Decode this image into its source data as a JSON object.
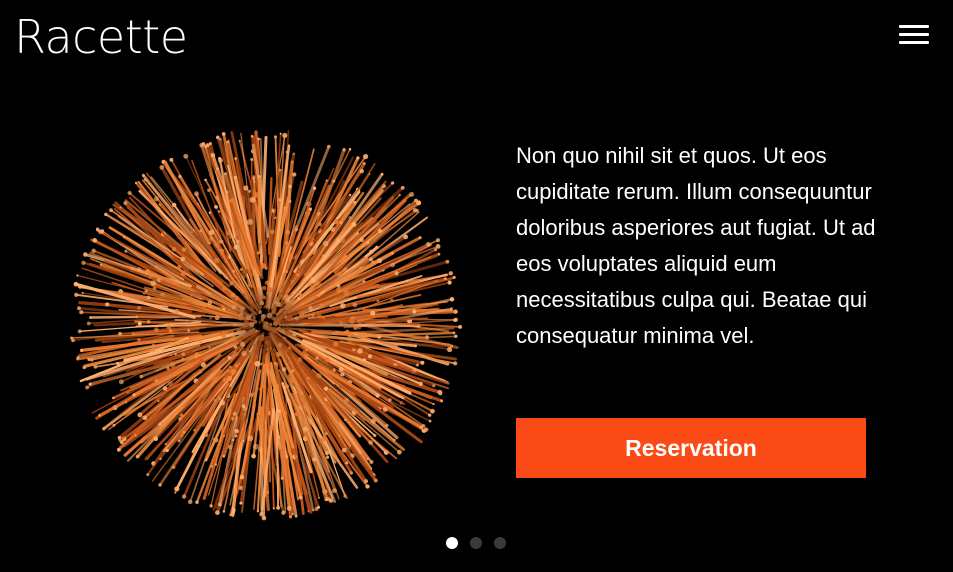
{
  "header": {
    "logo_text": "Racette",
    "menu_icon": "hamburger-menu-icon"
  },
  "hero": {
    "image_subject": "pasta-burst-image",
    "description": "Non quo nihil sit et quos. Ut eos cupiditate rerum. Illum consequuntur doloribus asperiores aut fugiat. Ut ad eos voluptates aliquid eum necessitatibus culpa qui. Beatae qui consequatur minima vel.",
    "cta_label": "Reservation"
  },
  "slider": {
    "slide_count": 3,
    "active_index": 0
  },
  "colors": {
    "background": "#000000",
    "accent": "#fa4a15",
    "dot_active": "#ffffff",
    "dot_inactive": "#3a3a3a",
    "pasta_primary": "#e8772f",
    "pasta_highlight": "#ffb070"
  }
}
